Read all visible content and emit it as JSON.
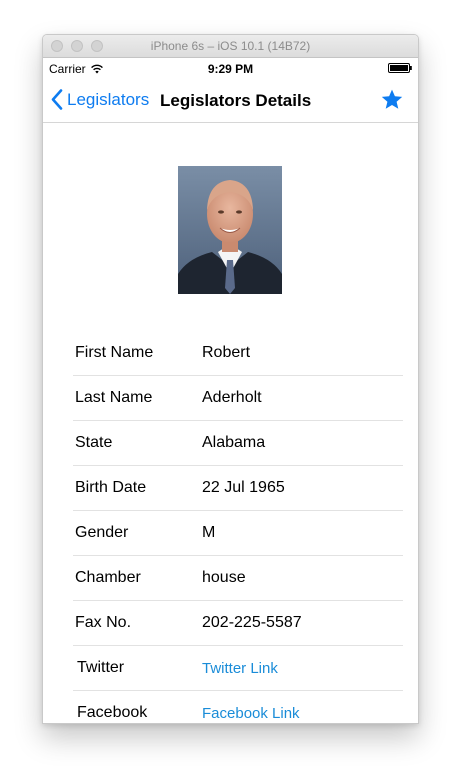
{
  "window": {
    "title": "iPhone 6s – iOS 10.1 (14B72)"
  },
  "status_bar": {
    "carrier": "Carrier",
    "time": "9:29 PM"
  },
  "nav": {
    "back_label": "Legislators",
    "title": "Legislators Details",
    "back_icon": "chevron-left-icon",
    "favorite_icon": "star-icon",
    "accent_color": "#0e7cf0"
  },
  "details": {
    "rows": [
      {
        "label": "First Name",
        "value": "Robert"
      },
      {
        "label": "Last Name",
        "value": "Aderholt"
      },
      {
        "label": "State",
        "value": "Alabama"
      },
      {
        "label": "Birth Date",
        "value": "22 Jul 1965"
      },
      {
        "label": "Gender",
        "value": "M"
      },
      {
        "label": "Chamber",
        "value": "house"
      },
      {
        "label": "Fax No.",
        "value": "202-225-5587"
      },
      {
        "label": "Twitter",
        "value": "Twitter Link"
      },
      {
        "label": "Facebook",
        "value": "Facebook Link"
      }
    ],
    "link_color": "#1a8cd8"
  }
}
